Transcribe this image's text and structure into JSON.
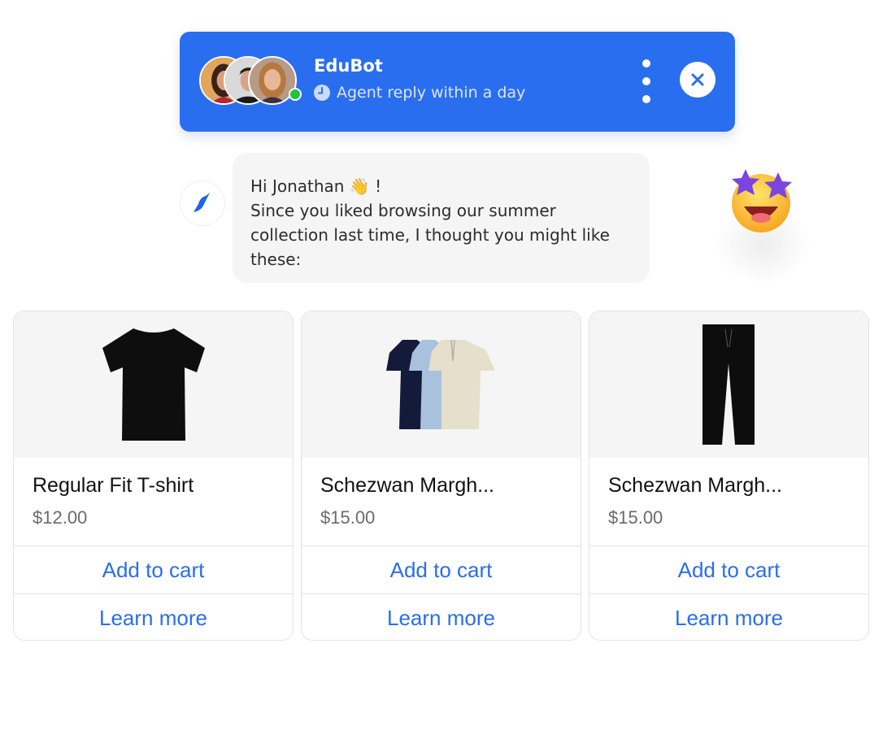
{
  "header": {
    "bot_name": "EduBot",
    "reply_status": "Agent reply within a day",
    "online": true,
    "brand_color": "#2a6ef0",
    "avatars": [
      "agent-1",
      "agent-2",
      "agent-3"
    ],
    "icons": {
      "clock": "clock-icon",
      "menu": "more-vertical-icon",
      "close": "close-icon"
    }
  },
  "message": {
    "sender_icon": "bird-logo-icon",
    "greeting": "Hi Jonathan",
    "greeting_emoji": "👋",
    "greeting_suffix": " !",
    "body": "Since you liked browsing our summer collection last time, I thought you might like these:"
  },
  "floating_emoji": "🤩",
  "products": [
    {
      "name": "Regular Fit T-shirt",
      "price": "$12.00",
      "image": "black-tshirt",
      "add_to_cart_label": "Add to cart",
      "learn_more_label": "Learn more"
    },
    {
      "name": "Schezwan Margh...",
      "price": "$15.00",
      "image": "polo-shirts-3-pack",
      "add_to_cart_label": "Add to cart",
      "learn_more_label": "Learn more"
    },
    {
      "name": "Schezwan Margh...",
      "price": "$15.00",
      "image": "black-trousers",
      "add_to_cart_label": "Add to cart",
      "learn_more_label": "Learn more"
    }
  ]
}
